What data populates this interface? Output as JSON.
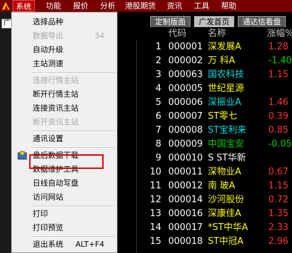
{
  "menubar": {
    "items": [
      {
        "label": "系统"
      },
      {
        "label": "功能"
      },
      {
        "label": "报价"
      },
      {
        "label": "分析"
      },
      {
        "label": "港股期货"
      },
      {
        "label": "资讯"
      },
      {
        "label": "工具"
      },
      {
        "label": "帮助"
      }
    ],
    "active_index": 0
  },
  "left_input": {
    "value": "广"
  },
  "system_menu": {
    "items": [
      {
        "label": "选择品种",
        "accel": "",
        "disabled": false
      },
      {
        "label": "数据导出",
        "accel": "34",
        "disabled": true
      },
      {
        "label": "自动升级",
        "accel": "",
        "disabled": false
      },
      {
        "label": "主站测速",
        "accel": "",
        "disabled": false
      },
      {
        "label": "连接行情主站",
        "accel": "",
        "disabled": true
      },
      {
        "label": "断开行情主站",
        "accel": "",
        "disabled": false
      },
      {
        "label": "连接资讯主站",
        "accel": "",
        "disabled": false
      },
      {
        "label": "断开资讯主站",
        "accel": "",
        "disabled": true
      },
      {
        "label": "通讯设置",
        "accel": "",
        "disabled": false
      },
      {
        "label": "盘后数据下载",
        "accel": "",
        "disabled": false,
        "icon": "download-icon"
      },
      {
        "label": "数据维护工具",
        "accel": "",
        "disabled": false,
        "highlighted": true
      },
      {
        "label": "日线自动写盘",
        "accel": "",
        "disabled": false
      },
      {
        "label": "访问网站",
        "accel": "",
        "disabled": false
      },
      {
        "label": "打印",
        "accel": "",
        "disabled": false
      },
      {
        "label": "打印预览",
        "accel": "",
        "disabled": false
      },
      {
        "label": "退出系统",
        "accel": "ALT+F4",
        "disabled": false
      }
    ]
  },
  "tabs": [
    {
      "label": "定制版面"
    },
    {
      "label": "广发首页"
    },
    {
      "label": "通达信看盘"
    }
  ],
  "active_tab": 1,
  "table": {
    "headers": {
      "code": "代码",
      "name": "名称",
      "change": "涨幅%"
    },
    "rows": [
      {
        "idx": "1",
        "code": "000001",
        "name": "深发展A",
        "name_color": "#ffff00",
        "change": "1.28",
        "change_color": "#ff3030"
      },
      {
        "idx": "2",
        "code": "000002",
        "name": "万  科A",
        "name_color": "#ffff00",
        "change": "-1.40",
        "change_color": "#00d000"
      },
      {
        "idx": "3",
        "code": "000063",
        "name": "国农科技",
        "name_color": "#00e0e0",
        "change": "1.15",
        "change_color": "#ff3030"
      },
      {
        "idx": "4",
        "code": "000005",
        "name": "世纪星源",
        "name_color": "#ffff00",
        "change": "",
        "change_color": "#ff3030"
      },
      {
        "idx": "5",
        "code": "000006",
        "name": "深振业A",
        "name_color": "#00e0e0",
        "change": "1.46",
        "change_color": "#ff3030"
      },
      {
        "idx": "6",
        "code": "000007",
        "name": "ST零七",
        "name_color": "#ffff00",
        "change": "0.39",
        "change_color": "#ff3030"
      },
      {
        "idx": "7",
        "code": "000008",
        "name": "ST宝利来",
        "name_color": "#00e0e0",
        "change": "0.85",
        "change_color": "#ff3030"
      },
      {
        "idx": "8",
        "code": "000009",
        "name": "中国宝安",
        "name_color": "#00d000",
        "change": "-0.05",
        "change_color": "#00d000"
      },
      {
        "idx": "9",
        "code": "000010",
        "name": "S ST华新",
        "name_color": "#ffffff",
        "change": "",
        "change_color": "#ff3030"
      },
      {
        "idx": "10",
        "code": "000011",
        "name": "深物业A",
        "name_color": "#ffff00",
        "change": "0.67",
        "change_color": "#ff3030"
      },
      {
        "idx": "11",
        "code": "000012",
        "name": "南  玻A",
        "name_color": "#ffff00",
        "change": "1.15",
        "change_color": "#ff3030"
      },
      {
        "idx": "12",
        "code": "000014",
        "name": "沙河股份",
        "name_color": "#ffff00",
        "change": "0.72",
        "change_color": "#ff3030"
      },
      {
        "idx": "13",
        "code": "000016",
        "name": "深康佳A",
        "name_color": "#ffff00",
        "change": "1.35",
        "change_color": "#ff3030"
      },
      {
        "idx": "14",
        "code": "000017",
        "name": "*ST中华A",
        "name_color": "#ffff00",
        "change": "2.33",
        "change_color": "#ff3030"
      },
      {
        "idx": "15",
        "code": "000018",
        "name": "ST中冠A",
        "name_color": "#ffff00",
        "change": "2.96",
        "change_color": "#ff3030"
      }
    ]
  }
}
